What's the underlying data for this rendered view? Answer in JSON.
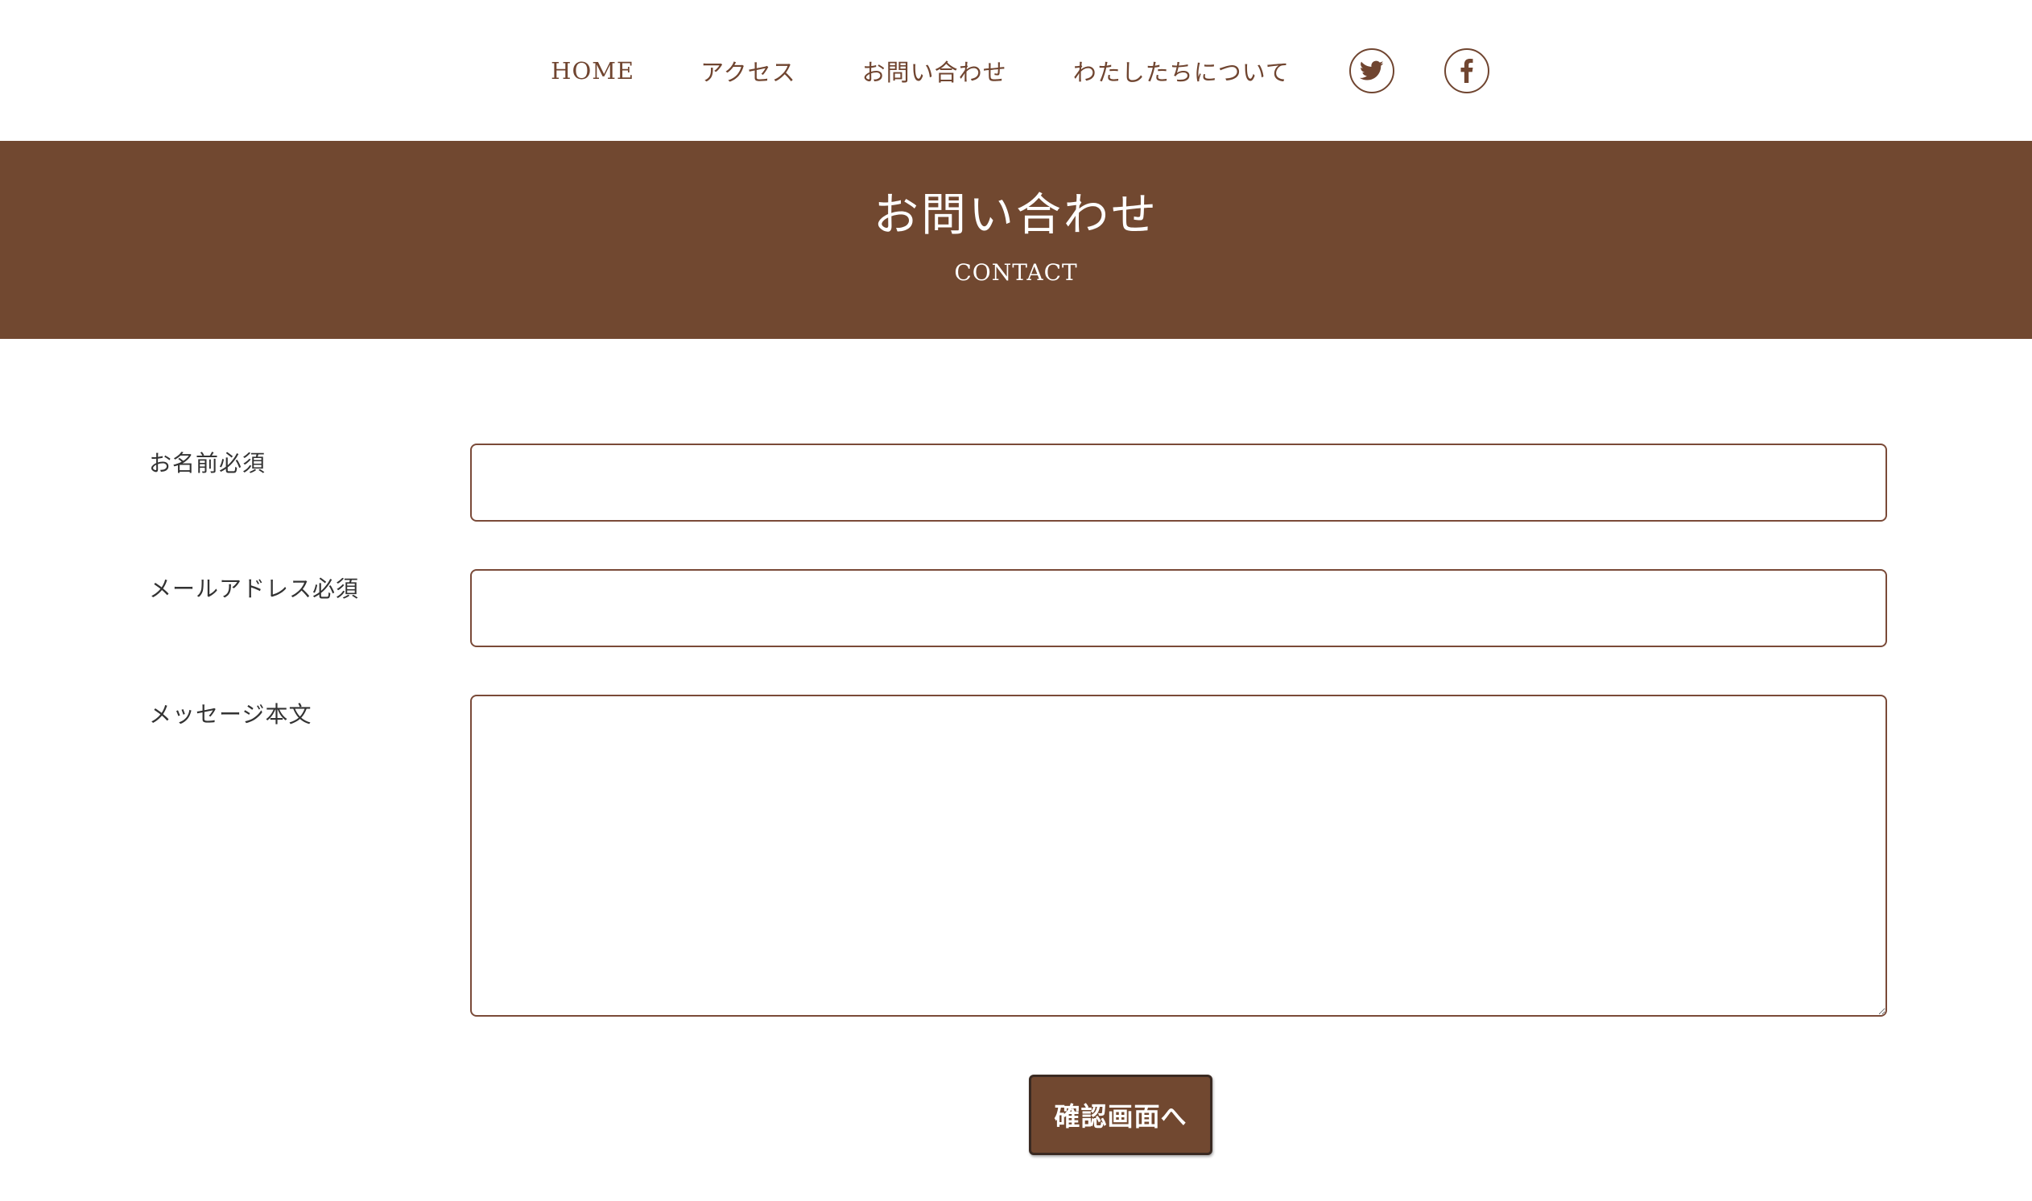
{
  "header": {
    "nav": [
      {
        "label": "HOME"
      },
      {
        "label": "アクセス"
      },
      {
        "label": "お問い合わせ"
      },
      {
        "label": "わたしたちについて"
      }
    ],
    "social": [
      {
        "icon": "twitter-icon"
      },
      {
        "icon": "facebook-icon"
      }
    ]
  },
  "hero": {
    "title": "お問い合わせ",
    "subtitle": "CONTACT"
  },
  "form": {
    "name_label": "お名前必須",
    "name_value": "",
    "email_label": "メールアドレス必須",
    "email_value": "",
    "message_label": "メッセージ本文",
    "message_value": "",
    "submit_label": "確認画面へ"
  },
  "colors": {
    "brand": "#714830",
    "link": "#704530",
    "border": "#7a4a38",
    "background": "#ffffff"
  }
}
